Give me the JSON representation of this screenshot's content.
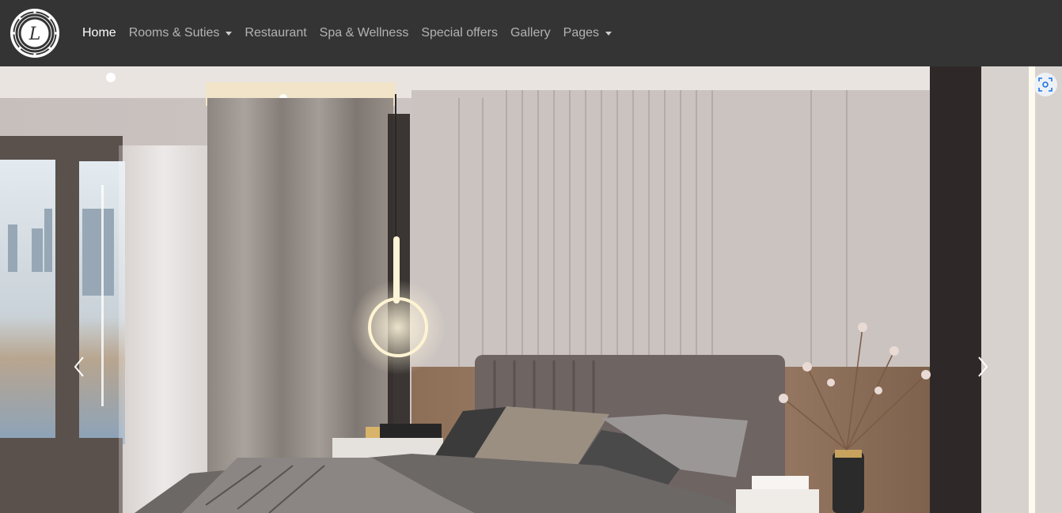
{
  "brand": {
    "logo_letter": "L",
    "logo_icon": "ornate-round-emblem"
  },
  "nav": {
    "items": [
      {
        "label": "Home",
        "active": true,
        "dropdown": false
      },
      {
        "label": "Rooms & Suties",
        "active": false,
        "dropdown": true
      },
      {
        "label": "Restaurant",
        "active": false,
        "dropdown": false
      },
      {
        "label": "Spa & Wellness",
        "active": false,
        "dropdown": false
      },
      {
        "label": "Special offers",
        "active": false,
        "dropdown": false
      },
      {
        "label": "Gallery",
        "active": false,
        "dropdown": false
      },
      {
        "label": "Pages",
        "active": false,
        "dropdown": true
      }
    ]
  },
  "carousel": {
    "prev_icon": "chevron-left-icon",
    "next_icon": "chevron-right-icon",
    "lens_icon": "visual-search-icon",
    "slide_subject": "luxury-bedroom-photo"
  },
  "colors": {
    "navbar_bg": "#343434",
    "nav_active": "#ffffff",
    "nav_inactive": "#c2c2c2",
    "lens_accent": "#1a73e8"
  }
}
